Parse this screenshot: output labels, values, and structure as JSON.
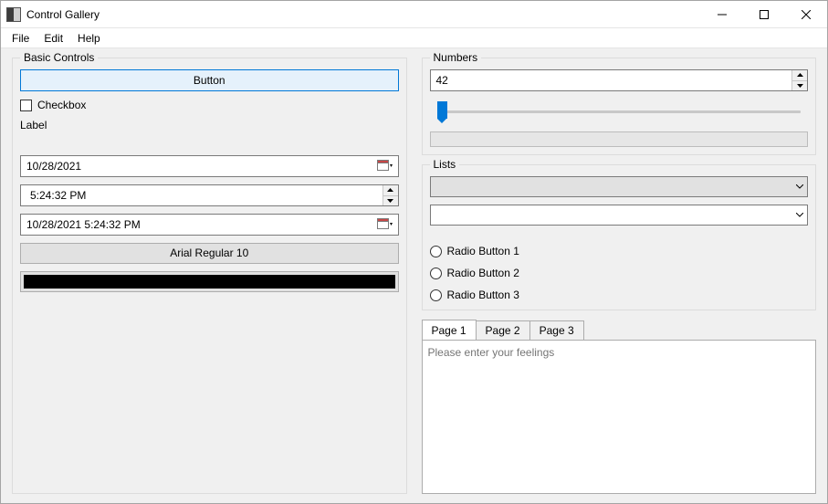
{
  "window": {
    "title": "Control Gallery"
  },
  "menu": {
    "file": "File",
    "edit": "Edit",
    "help": "Help"
  },
  "basic": {
    "group_title": "Basic Controls",
    "button_label": "Button",
    "checkbox_label": "Checkbox",
    "label_text": "Label",
    "date_value": "10/28/2021",
    "time_value": "5:24:32 PM",
    "datetime_value": "10/28/2021   5:24:32 PM",
    "font_label": "Arial Regular 10",
    "color_value": "#000000"
  },
  "numbers": {
    "group_title": "Numbers",
    "spinner_value": "42"
  },
  "lists": {
    "group_title": "Lists",
    "radios": [
      "Radio Button 1",
      "Radio Button 2",
      "Radio Button 3"
    ]
  },
  "tabs": {
    "items": [
      "Page 1",
      "Page 2",
      "Page 3"
    ],
    "textarea_placeholder": "Please enter your feelings"
  }
}
